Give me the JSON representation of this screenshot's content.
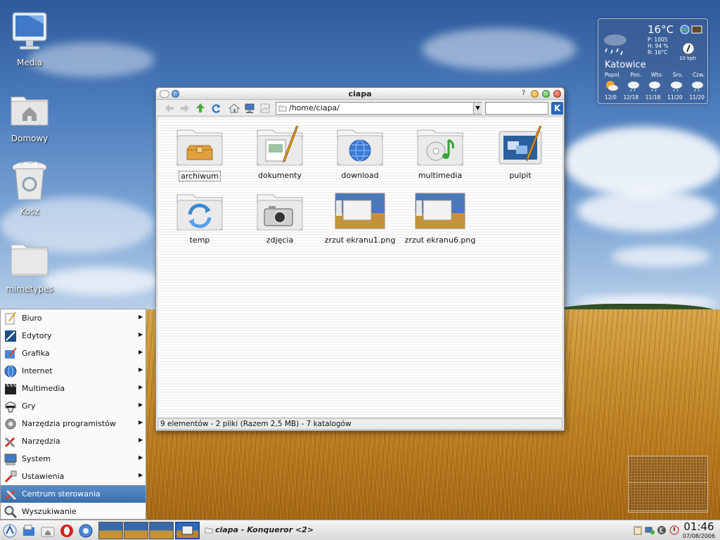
{
  "desktop": {
    "icons": [
      {
        "label": "Media",
        "icon": "computer-monitor-icon"
      },
      {
        "label": "Domowy",
        "icon": "home-folder-icon"
      },
      {
        "label": "Kosz",
        "icon": "trash-icon"
      },
      {
        "label": "mimetypes",
        "icon": "folder-icon"
      }
    ]
  },
  "weather": {
    "temperature": "16°C",
    "details": [
      "P: 1005",
      "H: 94 %",
      "R: 16°C"
    ],
    "wind": "10 kph",
    "city": "Katowice",
    "days": [
      "Popoł.",
      "Pon.",
      "Wto.",
      "Śro.",
      "Czw."
    ],
    "forecast_temps": [
      "12/0",
      "12/18",
      "11/18",
      "11/20",
      "11/20"
    ]
  },
  "window": {
    "title": "ciapa",
    "help_glyph": "?",
    "location": "/home/ciapa/",
    "files": [
      {
        "label": "archiwum",
        "icon": "archive-folder-icon"
      },
      {
        "label": "dokumenty",
        "icon": "documents-folder-icon"
      },
      {
        "label": "download",
        "icon": "download-folder-icon"
      },
      {
        "label": "multimedia",
        "icon": "multimedia-folder-icon"
      },
      {
        "label": "pulpit",
        "icon": "desktop-folder-icon"
      },
      {
        "label": "temp",
        "icon": "temp-folder-icon"
      },
      {
        "label": "zdjęcia",
        "icon": "photos-folder-icon"
      },
      {
        "label": "zrzut ekranu1.png",
        "icon": "image-thumbnail-icon"
      },
      {
        "label": "zrzut ekranu6.png",
        "icon": "image-thumbnail-icon"
      }
    ],
    "status": "9 elementów - 2 pliki (Razem 2,5 MB) - 7 katalogów"
  },
  "kmenu": {
    "items": [
      {
        "label": "Biuro",
        "icon": "office-icon",
        "submenu": true
      },
      {
        "label": "Edytory",
        "icon": "editors-icon",
        "submenu": true
      },
      {
        "label": "Grafika",
        "icon": "graphics-icon",
        "submenu": true
      },
      {
        "label": "Internet",
        "icon": "internet-globe-icon",
        "submenu": true
      },
      {
        "label": "Multimedia",
        "icon": "multimedia-clapper-icon",
        "submenu": true
      },
      {
        "label": "Gry",
        "icon": "games-icon",
        "submenu": true
      },
      {
        "label": "Narzędzia programistów",
        "icon": "developer-tools-icon",
        "submenu": true
      },
      {
        "label": "Narzędzia",
        "icon": "tools-icon",
        "submenu": true
      },
      {
        "label": "System",
        "icon": "system-icon",
        "submenu": true
      },
      {
        "label": "Ustawienia",
        "icon": "settings-icon",
        "submenu": true
      },
      {
        "label": "Centrum sterowania",
        "icon": "control-center-icon",
        "submenu": false,
        "selected": true
      },
      {
        "label": "Wyszukiwanie",
        "icon": "search-icon",
        "submenu": false
      }
    ],
    "submenu_arrow": "▶"
  },
  "taskbar": {
    "task_label": "ciapa - Konqueror <2>",
    "clock_time": "01:46",
    "clock_date": "07/08/2006",
    "pager_active_index": 4
  },
  "colors": {
    "accent": "#3a6ea8",
    "close_button": "#e04030",
    "minimize_button": "#f0a020",
    "maximize_button": "#40b040"
  }
}
